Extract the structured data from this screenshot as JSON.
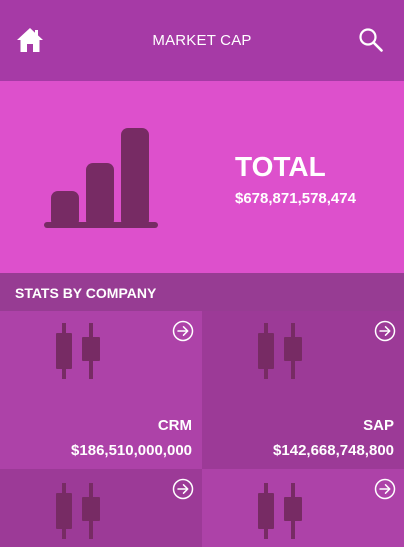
{
  "header": {
    "title": "MARKET CAP",
    "home_icon": "home-icon",
    "search_icon": "search-icon"
  },
  "total": {
    "label": "TOTAL",
    "value": "$678,871,578,474",
    "icon": "bar-chart-icon"
  },
  "section": {
    "title": "STATS BY COMPANY"
  },
  "companies": [
    {
      "name": "CRM",
      "value": "$186,510,000,000",
      "icon": "candlestick-icon",
      "action_icon": "arrow-circle-icon"
    },
    {
      "name": "SAP",
      "value": "$142,668,748,800",
      "icon": "candlestick-icon",
      "action_icon": "arrow-circle-icon"
    },
    {
      "name": "",
      "value": "",
      "icon": "candlestick-icon",
      "action_icon": "arrow-circle-icon"
    },
    {
      "name": "",
      "value": "",
      "icon": "candlestick-icon",
      "action_icon": "arrow-circle-icon"
    }
  ],
  "colors": {
    "header_bg": "#a63aa6",
    "hero_bg": "#dd50cc",
    "section_bg": "#973c93",
    "tile_a": "#ad42a8",
    "tile_b": "#9c3a97",
    "icon_dark": "#772b64"
  }
}
